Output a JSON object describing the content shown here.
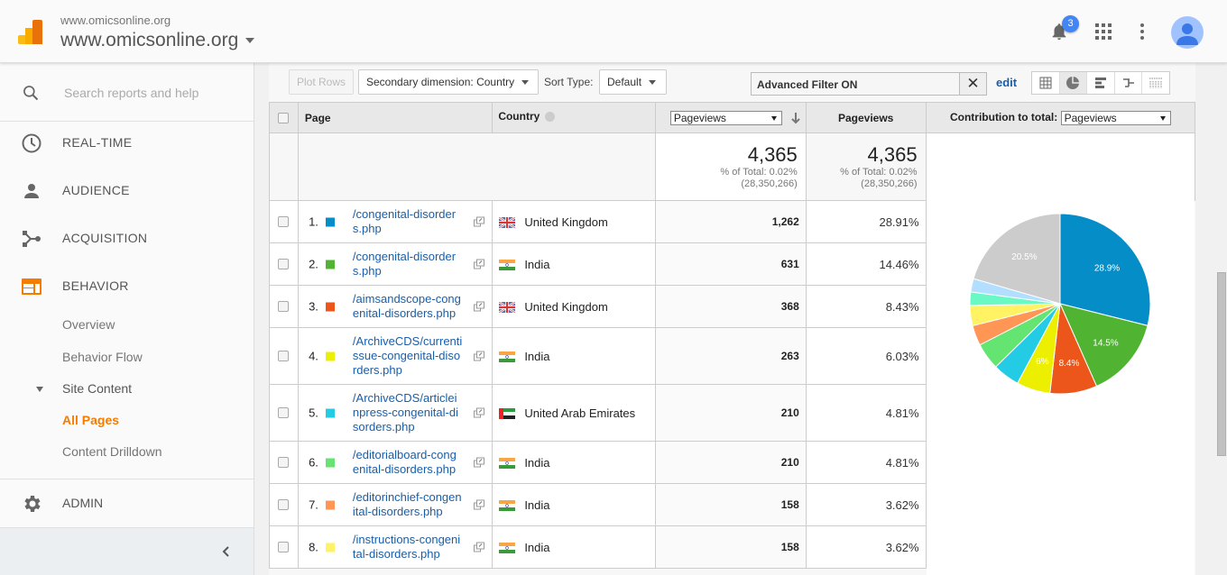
{
  "header": {
    "account_small": "www.omicsonline.org",
    "account_big": "www.omicsonline.org",
    "notification_count": "3"
  },
  "sidebar": {
    "search_placeholder": "Search reports and help",
    "nav": [
      {
        "label": "REAL-TIME",
        "icon": "clock-icon"
      },
      {
        "label": "AUDIENCE",
        "icon": "person-icon"
      },
      {
        "label": "ACQUISITION",
        "icon": "acquisition-icon"
      },
      {
        "label": "BEHAVIOR",
        "icon": "behavior-icon"
      }
    ],
    "behavior_sub": [
      "Overview",
      "Behavior Flow",
      "Site Content",
      "All Pages",
      "Content Drilldown"
    ],
    "admin_label": "ADMIN",
    "accent": "#f57c00"
  },
  "toolbar": {
    "plot_rows": "Plot Rows",
    "secondary_dimension": "Secondary dimension: Country",
    "sort_type_label": "Sort Type:",
    "sort_type_value": "Default",
    "filter_text": "Advanced Filter ON",
    "edit_link": "edit"
  },
  "table": {
    "headers": {
      "page": "Page",
      "country": "Country",
      "metric_select": "Pageviews",
      "pageviews": "Pageviews",
      "contribution_label": "Contribution to total:",
      "contribution_select": "Pageviews"
    },
    "totals": {
      "value1": "4,365",
      "pct1": "% of Total: 0.02%",
      "abs1": "(28,350,266)",
      "value2": "4,365",
      "pct2": "% of Total: 0.02%",
      "abs2": "(28,350,266)"
    },
    "rows": [
      {
        "rank": "1.",
        "color": "#058dc7",
        "page": "/congenital-disorders.php",
        "country": "United Kingdom",
        "flag": "uk",
        "pageviews": "1,262",
        "pct": "28.91%"
      },
      {
        "rank": "2.",
        "color": "#50b432",
        "page": "/congenital-disorders.php",
        "country": "India",
        "flag": "in",
        "pageviews": "631",
        "pct": "14.46%"
      },
      {
        "rank": "3.",
        "color": "#ed561b",
        "page": "/aimsandscope-congenital-disorders.php",
        "country": "United Kingdom",
        "flag": "uk",
        "pageviews": "368",
        "pct": "8.43%"
      },
      {
        "rank": "4.",
        "color": "#edef00",
        "page": "/ArchiveCDS/currentissue-congenital-disorders.php",
        "country": "India",
        "flag": "in",
        "pageviews": "263",
        "pct": "6.03%"
      },
      {
        "rank": "5.",
        "color": "#24cbe5",
        "page": "/ArchiveCDS/articleinpress-congenital-disorders.php",
        "country": "United Arab Emirates",
        "flag": "ae",
        "pageviews": "210",
        "pct": "4.81%"
      },
      {
        "rank": "6.",
        "color": "#64e572",
        "page": "/editorialboard-congenital-disorders.php",
        "country": "India",
        "flag": "in",
        "pageviews": "210",
        "pct": "4.81%"
      },
      {
        "rank": "7.",
        "color": "#ff9655",
        "page": "/editorinchief-congenital-disorders.php",
        "country": "India",
        "flag": "in",
        "pageviews": "158",
        "pct": "3.62%"
      },
      {
        "rank": "8.",
        "color": "#fff263",
        "page": "/instructions-congenital-disorders.php",
        "country": "India",
        "flag": "in",
        "pageviews": "158",
        "pct": "3.62%"
      }
    ]
  },
  "chart_data": {
    "type": "pie",
    "title": "Contribution to total: Pageviews",
    "slices": [
      {
        "label": "1",
        "value": 28.91,
        "color": "#058dc7",
        "data_label": "28.9%"
      },
      {
        "label": "2",
        "value": 14.46,
        "color": "#50b432",
        "data_label": "14.5%"
      },
      {
        "label": "3",
        "value": 8.43,
        "color": "#ed561b",
        "data_label": "8.4%"
      },
      {
        "label": "4",
        "value": 6.03,
        "color": "#edef00",
        "data_label": "6%"
      },
      {
        "label": "5",
        "value": 4.81,
        "color": "#24cbe5",
        "data_label": ""
      },
      {
        "label": "6",
        "value": 4.81,
        "color": "#64e572",
        "data_label": ""
      },
      {
        "label": "7",
        "value": 3.62,
        "color": "#ff9655",
        "data_label": ""
      },
      {
        "label": "8",
        "value": 3.62,
        "color": "#fff263",
        "data_label": ""
      },
      {
        "label": "9",
        "value": 2.41,
        "color": "#6af9c4",
        "data_label": ""
      },
      {
        "label": "10",
        "value": 2.4,
        "color": "#b2deff",
        "data_label": ""
      },
      {
        "label": "Other",
        "value": 20.5,
        "color": "#cccccc",
        "data_label": "20.5%"
      }
    ]
  }
}
